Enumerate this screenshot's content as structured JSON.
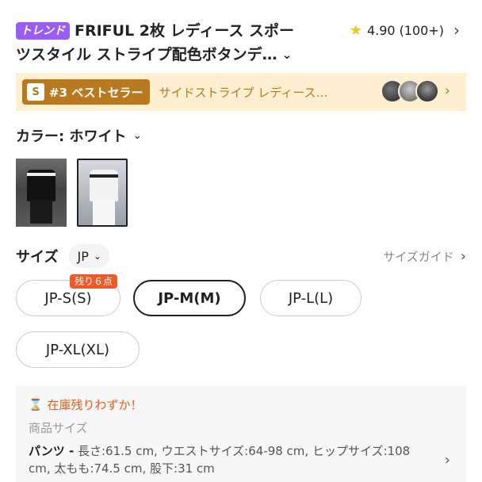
{
  "product": {
    "trend_badge": "トレンド",
    "title_line1": "FRIFUL 2枚 レディース スポー",
    "title_line2": "ツスタイル ストライプ配色ボタンデ…",
    "expand_icon": "chevron-down-icon",
    "rating": "4.90",
    "review_count": "(100+)"
  },
  "bestseller": {
    "rank_label": "#3 ベストセラー",
    "badge_icon_glyph": "S",
    "text": "サイドストライプ レディース…"
  },
  "color": {
    "label": "カラー: ホワイト"
  },
  "size": {
    "label": "サイズ",
    "region": "JP",
    "guide_label": "サイズガイド",
    "options": [
      "JP-S(S)",
      "JP-M(M)",
      "JP-L(L)",
      "JP-XL(XL)"
    ],
    "selected": "JP-M(M)",
    "stock_tag": "残り６点"
  },
  "info": {
    "low_stock": "在庫残りわずか！",
    "heading": "商品サイズ",
    "product_name": "パンツ -",
    "spec": " 長さ:61.5 cm, ウエストサイズ:64-98 cm, ヒップサイズ:108 cm, 太もも:74.5 cm, 股下:31 cm"
  },
  "colors": {
    "trend": "#9b5cf6",
    "bestseller_bg": "#fdefcf",
    "bestseller_accent": "#b8791f",
    "star": "#f5c518",
    "stock_orange": "#f05a28"
  }
}
